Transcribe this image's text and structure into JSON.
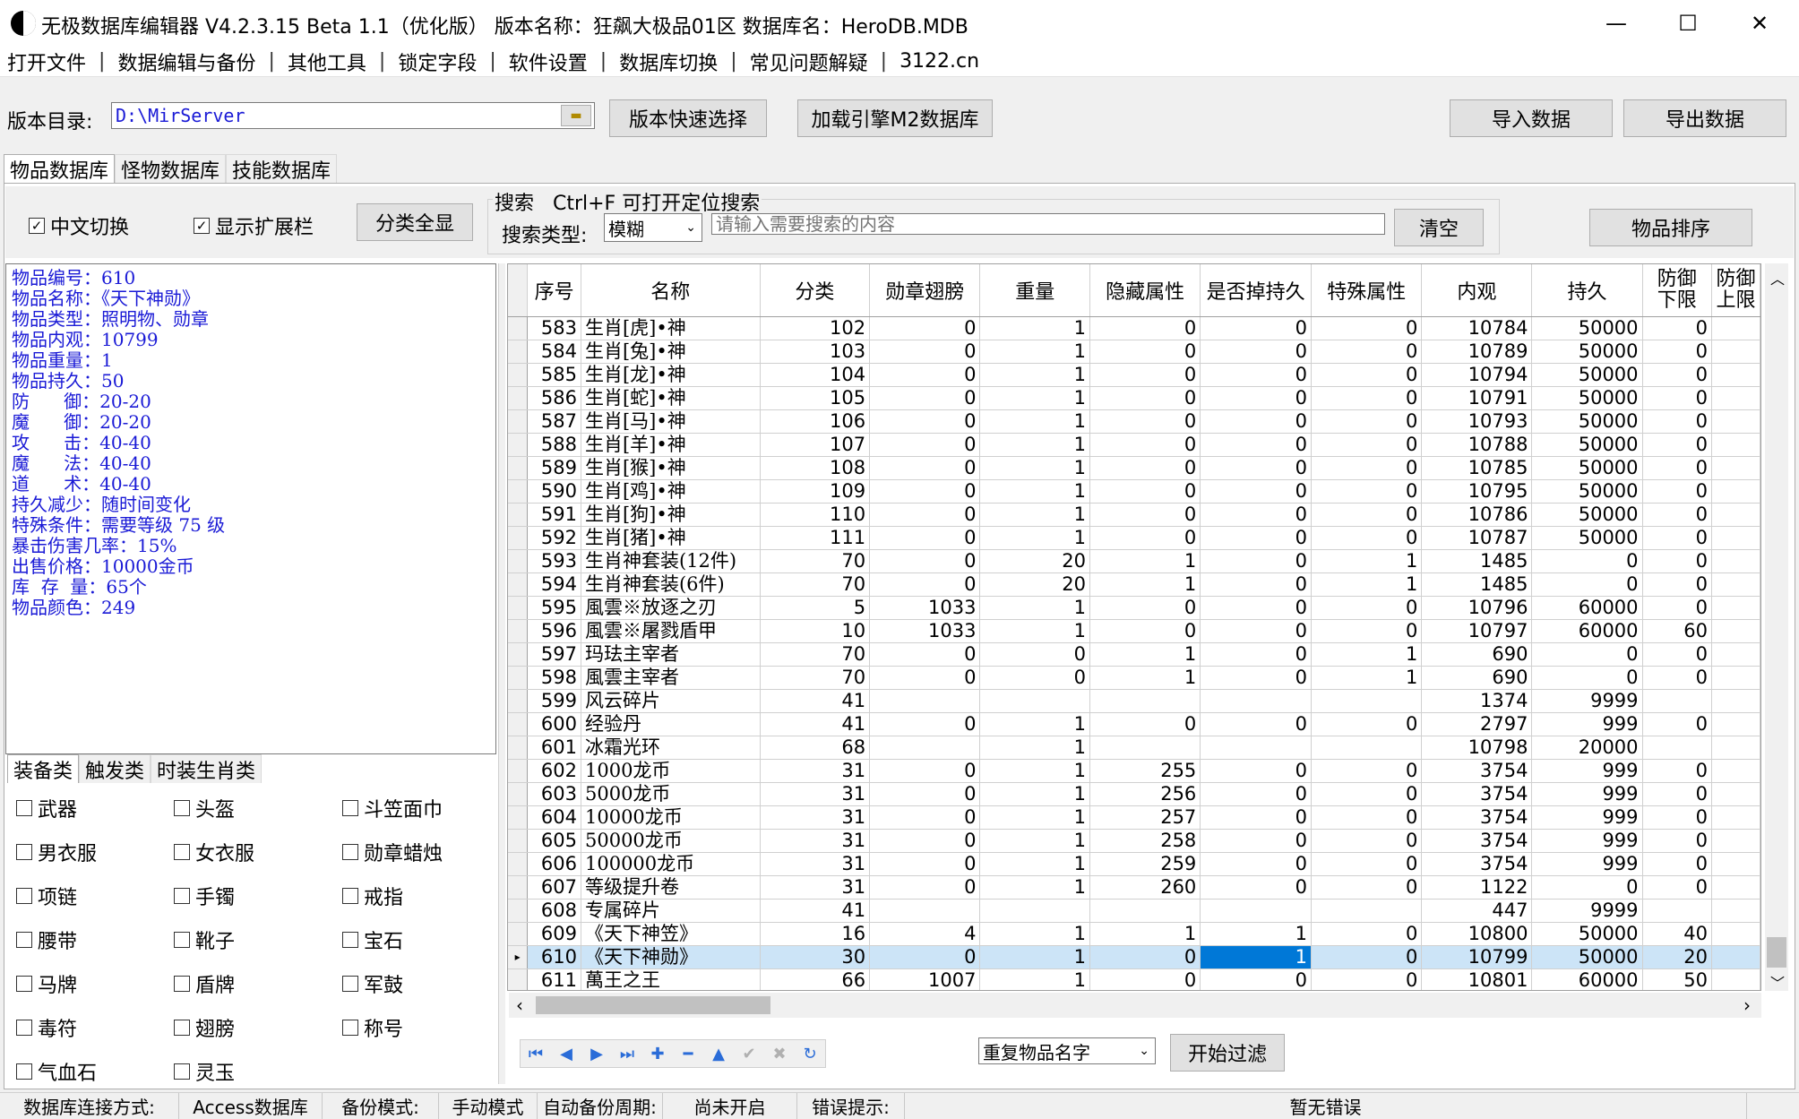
{
  "window": {
    "title": "无极数据库编辑器 V4.2.3.15    Beta 1.1（优化版）    版本名称：狂飙大极品01区    数据库名：HeroDB.MDB",
    "minimize": "—",
    "maximize": "☐",
    "close": "✕"
  },
  "menu": [
    "打开文件",
    "数据编辑与备份",
    "其他工具",
    "锁定字段",
    "软件设置",
    "数据库切换",
    "常见问题解疑",
    "3122.cn"
  ],
  "menu_sep": "|",
  "toolbar": {
    "dir_label": "版本目录:",
    "dir_value": "D:\\MirServer",
    "quick_select": "版本快速选择",
    "load_m2": "加载引擎M2数据库",
    "import": "导入数据",
    "export": "导出数据"
  },
  "main_tabs": [
    "物品数据库",
    "怪物数据库",
    "技能数据库"
  ],
  "options": {
    "chinese_switch": "中文切换",
    "show_ext": "显示扩展栏",
    "show_all": "分类全显",
    "search_title": "搜索   Ctrl+F 可打开定位搜索",
    "search_type_label": "搜索类型:",
    "search_type_value": "模糊",
    "search_placeholder": "请输入需要搜索的内容",
    "clear": "清空",
    "sort": "物品排序"
  },
  "info_lines": [
    "物品编号：610",
    "物品名称：《天下神勋》",
    "物品类型：照明物、勋章",
    "物品内观：10799",
    "物品重量：1",
    "物品持久：50",
    "防      御：20-20",
    "魔      御：20-20",
    "攻      击：40-40",
    "魔      法：40-40",
    "道      术：40-40",
    "持久减少：随时间变化",
    "特殊条件：需要等级 75 级",
    "暴击伤害几率：15%",
    "出售价格：10000金币",
    "库  存  量：65个",
    "物品颜色：249"
  ],
  "category_tabs": [
    "装备类",
    "触发类",
    "时装生肖类"
  ],
  "categories": [
    [
      "武器",
      "头盔",
      "斗笠面巾"
    ],
    [
      "男衣服",
      "女衣服",
      "勋章蜡烛"
    ],
    [
      "项链",
      "手镯",
      "戒指"
    ],
    [
      "腰带",
      "靴子",
      "宝石"
    ],
    [
      "马牌",
      "盾牌",
      "军鼓"
    ],
    [
      "毒符",
      "翅膀",
      "称号"
    ],
    [
      "气血石",
      "灵玉"
    ]
  ],
  "grid": {
    "columns": [
      "序号",
      "名称",
      "分类",
      "勋章翅膀",
      "重量",
      "隐藏属性",
      "是否掉持久",
      "特殊属性",
      "内观",
      "持久",
      "防御下限",
      "防御上限"
    ],
    "rows": [
      [
        "583",
        "生肖[虎]•神",
        "102",
        "0",
        "1",
        "0",
        "0",
        "0",
        "10784",
        "50000",
        "0"
      ],
      [
        "584",
        "生肖[兔]•神",
        "103",
        "0",
        "1",
        "0",
        "0",
        "0",
        "10789",
        "50000",
        "0"
      ],
      [
        "585",
        "生肖[龙]•神",
        "104",
        "0",
        "1",
        "0",
        "0",
        "0",
        "10794",
        "50000",
        "0"
      ],
      [
        "586",
        "生肖[蛇]•神",
        "105",
        "0",
        "1",
        "0",
        "0",
        "0",
        "10791",
        "50000",
        "0"
      ],
      [
        "587",
        "生肖[马]•神",
        "106",
        "0",
        "1",
        "0",
        "0",
        "0",
        "10793",
        "50000",
        "0"
      ],
      [
        "588",
        "生肖[羊]•神",
        "107",
        "0",
        "1",
        "0",
        "0",
        "0",
        "10788",
        "50000",
        "0"
      ],
      [
        "589",
        "生肖[猴]•神",
        "108",
        "0",
        "1",
        "0",
        "0",
        "0",
        "10785",
        "50000",
        "0"
      ],
      [
        "590",
        "生肖[鸡]•神",
        "109",
        "0",
        "1",
        "0",
        "0",
        "0",
        "10795",
        "50000",
        "0"
      ],
      [
        "591",
        "生肖[狗]•神",
        "110",
        "0",
        "1",
        "0",
        "0",
        "0",
        "10786",
        "50000",
        "0"
      ],
      [
        "592",
        "生肖[猪]•神",
        "111",
        "0",
        "1",
        "0",
        "0",
        "0",
        "10787",
        "50000",
        "0"
      ],
      [
        "593",
        "生肖神套装(12件)",
        "70",
        "0",
        "20",
        "1",
        "0",
        "1",
        "1485",
        "0",
        "0"
      ],
      [
        "594",
        "生肖神套装(6件)",
        "70",
        "0",
        "20",
        "1",
        "0",
        "1",
        "1485",
        "0",
        "0"
      ],
      [
        "595",
        "風雲※放逐之刃",
        "5",
        "1033",
        "1",
        "0",
        "0",
        "0",
        "10796",
        "60000",
        "0"
      ],
      [
        "596",
        "風雲※屠戮盾甲",
        "10",
        "1033",
        "1",
        "0",
        "0",
        "0",
        "10797",
        "60000",
        "60"
      ],
      [
        "597",
        "玛珐主宰者",
        "70",
        "0",
        "0",
        "1",
        "0",
        "1",
        "690",
        "0",
        "0"
      ],
      [
        "598",
        "風雲主宰者",
        "70",
        "0",
        "0",
        "1",
        "0",
        "1",
        "690",
        "0",
        "0"
      ],
      [
        "599",
        "风云碎片",
        "41",
        "",
        "",
        "",
        "",
        "",
        "1374",
        "9999",
        ""
      ],
      [
        "600",
        "经验丹",
        "41",
        "0",
        "1",
        "0",
        "0",
        "0",
        "2797",
        "999",
        "0"
      ],
      [
        "601",
        "冰霜光环",
        "68",
        "",
        "1",
        "",
        "",
        "",
        "10798",
        "20000",
        ""
      ],
      [
        "602",
        "1000龙币",
        "31",
        "0",
        "1",
        "255",
        "0",
        "0",
        "3754",
        "999",
        "0"
      ],
      [
        "603",
        "5000龙币",
        "31",
        "0",
        "1",
        "256",
        "0",
        "0",
        "3754",
        "999",
        "0"
      ],
      [
        "604",
        "10000龙币",
        "31",
        "0",
        "1",
        "257",
        "0",
        "0",
        "3754",
        "999",
        "0"
      ],
      [
        "605",
        "50000龙币",
        "31",
        "0",
        "1",
        "258",
        "0",
        "0",
        "3754",
        "999",
        "0"
      ],
      [
        "606",
        "100000龙币",
        "31",
        "0",
        "1",
        "259",
        "0",
        "0",
        "3754",
        "999",
        "0"
      ],
      [
        "607",
        "等级提升卷",
        "31",
        "0",
        "1",
        "260",
        "0",
        "0",
        "1122",
        "0",
        "0"
      ],
      [
        "608",
        "专属碎片",
        "41",
        "",
        "",
        "",
        "",
        "",
        "447",
        "9999",
        ""
      ],
      [
        "609",
        "《天下神笠》",
        "16",
        "4",
        "1",
        "1",
        "1",
        "0",
        "10800",
        "50000",
        "40"
      ],
      [
        "610",
        "《天下神勋》",
        "30",
        "0",
        "1",
        "0",
        "1",
        "0",
        "10799",
        "50000",
        "20"
      ],
      [
        "611",
        "萬王之王",
        "66",
        "1007",
        "1",
        "0",
        "0",
        "0",
        "10801",
        "60000",
        "50"
      ]
    ],
    "selected_row": 27
  },
  "filter": {
    "select_value": "重复物品名字",
    "start": "开始过滤"
  },
  "status": [
    "数据库连接方式:",
    "Access数据库",
    "备份模式:",
    "手动模式",
    "自动备份周期:",
    "尚未开启",
    "错误提示:",
    "暂无错误"
  ],
  "colors": {
    "info_text": "#1a1ad6",
    "selected_row": "#cce4f7",
    "selected_cell": "#0078d7"
  }
}
